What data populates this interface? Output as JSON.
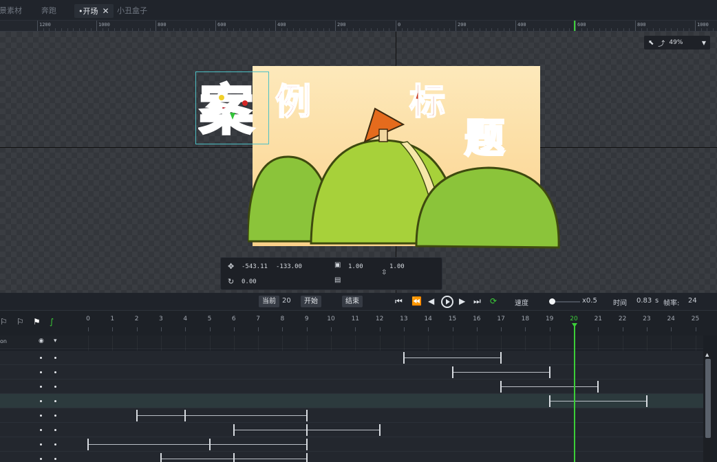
{
  "tabs": [
    {
      "label": "背景素材"
    },
    {
      "label": "奔跑"
    },
    {
      "label": "•开场",
      "close": "✕"
    },
    {
      "label": "小丑盒子"
    }
  ],
  "ruler": {
    "labels": [
      "1200",
      "1000",
      "800",
      "600",
      "400",
      "200",
      "0",
      "200",
      "400",
      "600",
      "800",
      "1000"
    ]
  },
  "zoom": {
    "value": "49%",
    "dropdown": "▼"
  },
  "props": {
    "x": "-543.11",
    "y": "-133.00",
    "rotation": "0.00",
    "scale_x": "1.00",
    "scale_y": "1.00"
  },
  "transport": {
    "current_label": "当前",
    "current_value": "20",
    "start_label": "开始",
    "end_label": "结束",
    "speed_label": "速度",
    "speed_value": "x0.5",
    "time_label": "时间",
    "time_value": "0.83",
    "time_unit": "s",
    "fps_label": "帧率:",
    "fps_value": "24"
  },
  "timeline": {
    "frames": [
      "0",
      "1",
      "2",
      "3",
      "4",
      "5",
      "6",
      "7",
      "8",
      "9",
      "10",
      "11",
      "12",
      "13",
      "14",
      "15",
      "16",
      "17",
      "18",
      "19",
      "20",
      "21",
      "22",
      "23",
      "24",
      "25"
    ],
    "current_frame": 20,
    "header_label": "on",
    "rows": [
      {
        "segments": [
          [
            13,
            17
          ]
        ],
        "selected": false
      },
      {
        "segments": [
          [
            15,
            19
          ]
        ],
        "selected": false
      },
      {
        "segments": [
          [
            17,
            21
          ]
        ],
        "selected": false
      },
      {
        "segments": [
          [
            19,
            23
          ]
        ],
        "selected": true
      },
      {
        "segments": [
          [
            2,
            4
          ],
          [
            4,
            9
          ]
        ],
        "selected": false
      },
      {
        "segments": [
          [
            6,
            9
          ],
          [
            9,
            12
          ]
        ],
        "selected": false
      },
      {
        "segments": [
          [
            0,
            5
          ],
          [
            5,
            9
          ]
        ],
        "selected": false
      },
      {
        "segments": [
          [
            3,
            6
          ],
          [
            6,
            9
          ]
        ],
        "selected": false
      }
    ]
  },
  "colors": {
    "accent": "#3ccf38",
    "selection": "#4cc0c5"
  }
}
